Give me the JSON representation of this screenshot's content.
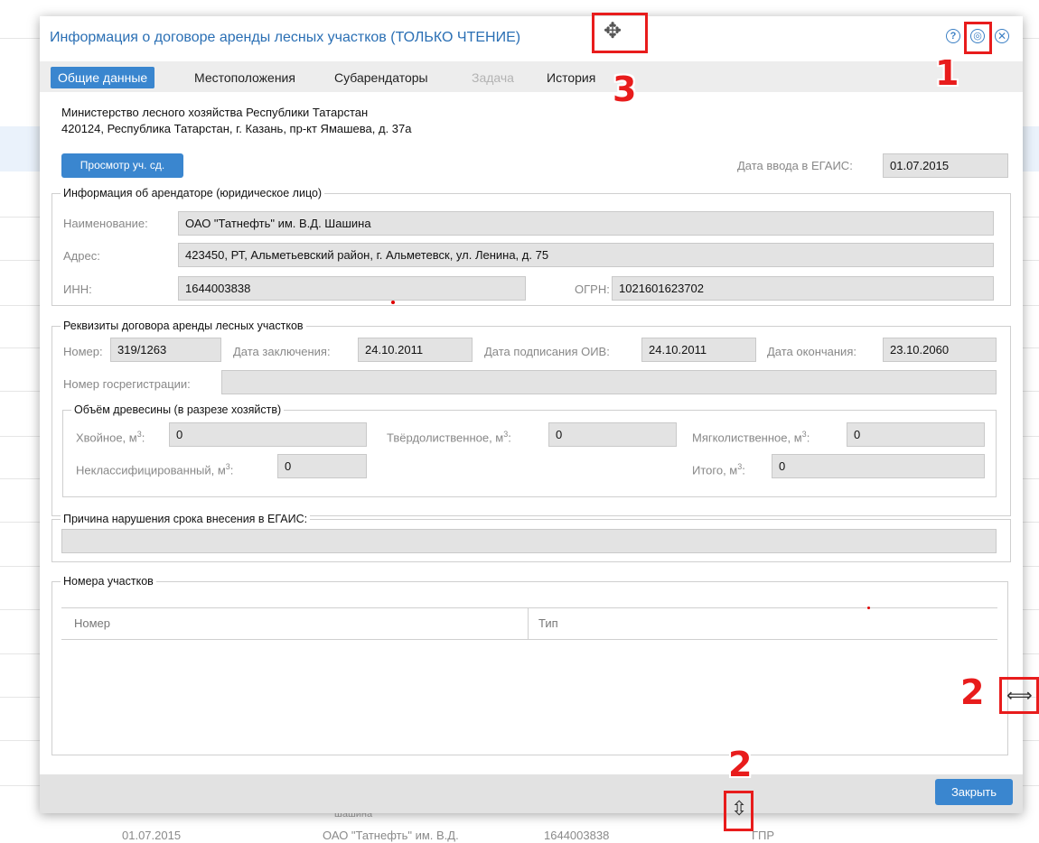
{
  "dialog": {
    "title": "Информация о договоре аренды лесных участков (ТОЛЬКО ЧТЕНИЕ)",
    "controls": {
      "help": "?",
      "pin": "◎",
      "close": "✕"
    }
  },
  "tabs": [
    {
      "label": "Общие данные",
      "state": "active"
    },
    {
      "label": "Местоположения",
      "state": "normal"
    },
    {
      "label": "Субарендаторы",
      "state": "normal"
    },
    {
      "label": "Задача",
      "state": "disabled"
    },
    {
      "label": "История",
      "state": "normal"
    }
  ],
  "organization": {
    "name": "Министерство лесного хозяйства Республики Татарстан",
    "address": "420124, Республика Татарстан, г. Казань, пр-кт Ямашева, д. 37а"
  },
  "view_button": "Просмотр уч. сд.",
  "egais_date": {
    "label": "Дата ввода в ЕГАИС:",
    "value": "01.07.2015"
  },
  "tenant": {
    "legend": "Информация об арендаторе (юридическое лицо)",
    "name_label": "Наименование:",
    "name_value": "ОАО \"Татнефть\" им. В.Д. Шашина",
    "address_label": "Адрес:",
    "address_value": "423450, РТ, Альметьевский район, г. Альметевск, ул. Ленина, д. 75",
    "inn_label": "ИНН:",
    "inn_value": "1644003838",
    "ogrn_label": "ОГРН:",
    "ogrn_value": "1021601623702"
  },
  "contract": {
    "legend": "Реквизиты договора аренды лесных участков",
    "number_label": "Номер:",
    "number_value": "319/1263",
    "concluded_label": "Дата заключения:",
    "concluded_value": "24.10.2011",
    "signed_label": "Дата подписания ОИВ:",
    "signed_value": "24.10.2011",
    "end_label": "Дата окончания:",
    "end_value": "23.10.2060",
    "reg_label": "Номер госрегистрации:",
    "reg_value": ""
  },
  "wood": {
    "legend": "Объём древесины (в разрезе хозяйств)",
    "conifer_label": "Хвойное, м",
    "conifer_value": "0",
    "hardwood_label": "Твёрдолиственное, м",
    "hardwood_value": "0",
    "softwood_label": "Мягколиственное, м",
    "softwood_value": "0",
    "unclass_label": "Неклассифицированный, м",
    "unclass_value": "0",
    "total_label": "Итого, м",
    "total_value": "0",
    "unit_sup": "3",
    "colon": ":"
  },
  "violation": {
    "legend": "Причина нарушения срока внесения в ЕГАИС:",
    "value": ""
  },
  "plots": {
    "legend": "Номера участков",
    "columns": [
      "Номер",
      "Тип"
    ]
  },
  "footer": {
    "close_button": "Закрыть"
  },
  "background_rows": {
    "faint_text": "шашина",
    "date": "01.07.2015",
    "org": "ОАО \"Татнефть\" им. В.Д.",
    "inn": "1644003838",
    "type": "ГПР"
  },
  "annotations": {
    "n1": "1",
    "n2a": "2",
    "n2b": "2",
    "n3": "3",
    "move_icon": "✥",
    "hresize_icon": "⟺",
    "vresize_icon": "⇳"
  },
  "colors": {
    "accent": "#3a86cf",
    "title": "#2a6fb4",
    "annotation": "#e81c1c"
  }
}
